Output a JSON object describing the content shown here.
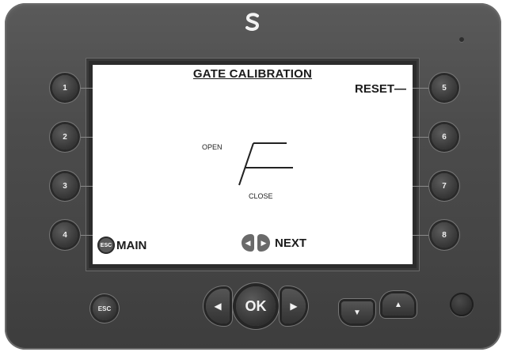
{
  "screen": {
    "title": "GATE CALIBRATION",
    "reset_label": "RESET—",
    "open_label": "OPEN",
    "close_label": "CLOSE",
    "main_label": "MAIN",
    "esc_badge": "ESC",
    "next_label": "NEXT"
  },
  "function_keys": [
    "1",
    "2",
    "3",
    "4",
    "5",
    "6",
    "7",
    "8"
  ],
  "nav": {
    "esc_label": "ESC",
    "ok_label": "OK",
    "left_symbol": "◀",
    "right_symbol": "▶",
    "down_symbol": "▼",
    "up_symbol": "▲"
  },
  "icons": {
    "brand_logo": "s-logo-icon"
  }
}
